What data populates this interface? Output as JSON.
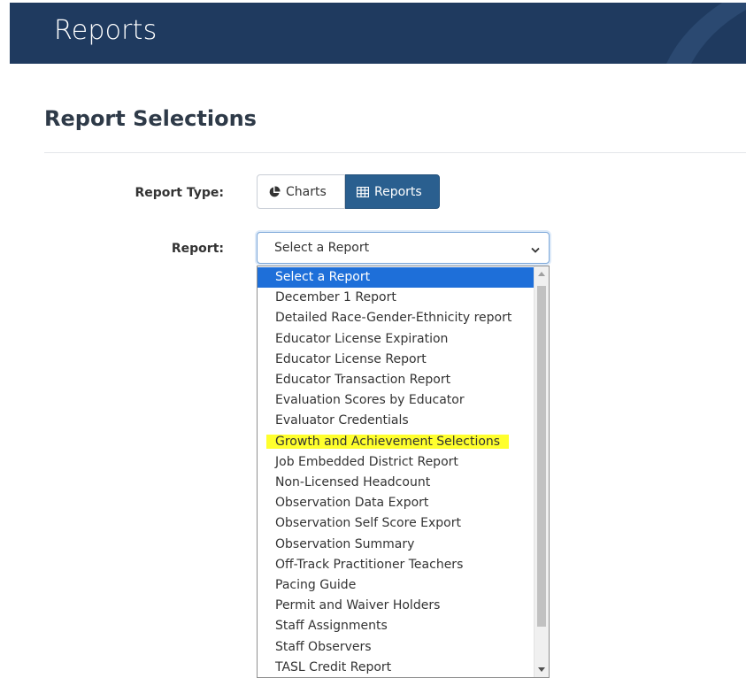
{
  "header": {
    "title": "Reports"
  },
  "section": {
    "title": "Report Selections"
  },
  "form": {
    "report_type_label": "Report Type:",
    "report_label": "Report:",
    "report_type_options": {
      "charts": "Charts",
      "reports": "Reports",
      "active": "Reports"
    },
    "report_select_value": "Select a Report"
  },
  "dropdown": {
    "options": [
      "Select a Report",
      "December 1 Report",
      "Detailed Race-Gender-Ethnicity report",
      "Educator License Expiration",
      "Educator License Report",
      "Educator Transaction Report",
      "Evaluation Scores by Educator",
      "Evaluator Credentials",
      "Growth and Achievement Selections",
      "Job Embedded District Report",
      "Non-Licensed Headcount",
      "Observation Data Export",
      "Observation Self Score Export",
      "Observation Summary",
      "Off-Track Practitioner Teachers",
      "Pacing Guide",
      "Permit and Waiver Holders",
      "Staff Assignments",
      "Staff Observers",
      "TASL Credit Report"
    ],
    "selected_index": 0,
    "highlighted_index": 8
  },
  "colors": {
    "header_bg": "#1f3a5f",
    "active_button": "#2a5f8f",
    "selected_option": "#1e6fd9",
    "highlight": "#ffff2d"
  },
  "icons": {
    "charts": "pie-chart-icon",
    "reports": "table-icon",
    "select": "chevron-down-icon"
  }
}
